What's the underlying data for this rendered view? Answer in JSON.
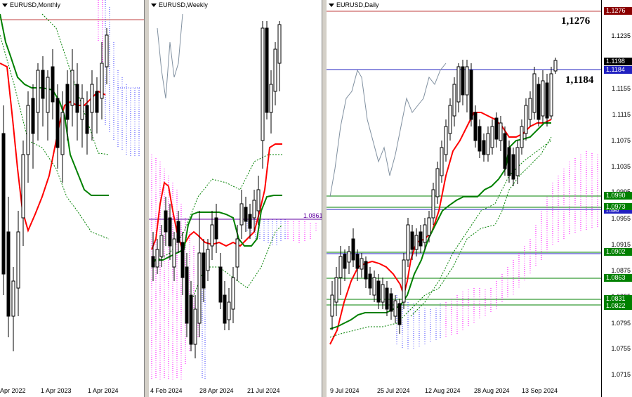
{
  "colors": {
    "tenkan": "#ff0000",
    "kijun": "#008000",
    "senkou": "#ff00ff",
    "senkou_b": "#0000ff",
    "resistance_tag": "#8b0000",
    "current_tag": "#000000",
    "blue_level": "#2020c0",
    "green_level": "#008000"
  },
  "panels": [
    {
      "id": "monthly",
      "title": "EURUSD,Monthly",
      "x_labels": [
        "Apr 2022",
        "1 Apr 2023",
        "1 Apr 2024"
      ]
    },
    {
      "id": "weekly",
      "title": "EURUSD,Weekly",
      "x_labels": [
        "4 Feb 2024",
        "28 Apr 2024",
        "21 Jul 2024"
      ],
      "level_label": "1.0861"
    },
    {
      "id": "daily",
      "title": "EURUSD,Daily",
      "x_labels": [
        "9 Jul 2024",
        "25 Jul 2024",
        "12 Aug 2024",
        "28 Aug 2024",
        "13 Sep 2024"
      ],
      "y_ticks": [
        "1.1235",
        "1.1155",
        "1.1115",
        "1.1075",
        "1.1035",
        "1.0995",
        "1.0955",
        "1.0915",
        "1.0875",
        "1.0835",
        "1.0795",
        "1.0755",
        "1.0715"
      ],
      "price_tags": [
        {
          "label": "1.1276",
          "kind": "resistance"
        },
        {
          "label": "1.1198",
          "kind": "current"
        },
        {
          "label": "1.1184",
          "kind": "blue"
        },
        {
          "label": "1.0990",
          "kind": "green"
        },
        {
          "label": "1.0973",
          "kind": "green"
        },
        {
          "label": "1.0969",
          "kind": "blue"
        },
        {
          "label": "1.0902",
          "kind": "green"
        },
        {
          "label": "1.0863",
          "kind": "green"
        },
        {
          "label": "1.0831",
          "kind": "green"
        },
        {
          "label": "1.0822",
          "kind": "green"
        }
      ],
      "annotations": [
        "1,1276",
        "1,1184"
      ]
    }
  ]
}
